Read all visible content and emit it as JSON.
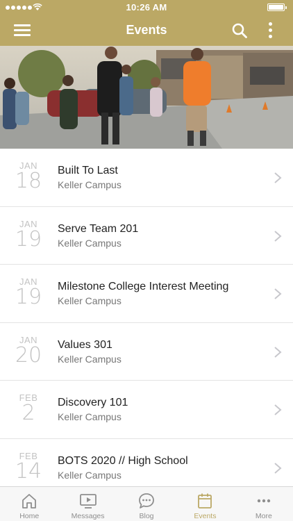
{
  "status_bar": {
    "time": "10:26 AM"
  },
  "nav": {
    "title": "Events"
  },
  "colors": {
    "accent": "#bba865",
    "inactive_tab": "#8e8e8e",
    "date_text": "#c3c3c3"
  },
  "events": [
    {
      "month": "JAN",
      "day": "18",
      "title": "Built To Last",
      "campus": "Keller Campus"
    },
    {
      "month": "JAN",
      "day": "19",
      "title": "Serve Team 201",
      "campus": "Keller Campus"
    },
    {
      "month": "JAN",
      "day": "19",
      "title": "Milestone College Interest Meeting",
      "campus": "Keller Campus"
    },
    {
      "month": "JAN",
      "day": "20",
      "title": "Values 301",
      "campus": "Keller Campus"
    },
    {
      "month": "FEB",
      "day": "2",
      "title": "Discovery 101",
      "campus": "Keller Campus"
    },
    {
      "month": "FEB",
      "day": "14",
      "title": "BOTS 2020 // High School",
      "campus": "Keller Campus"
    }
  ],
  "tabs": [
    {
      "label": "Home",
      "icon": "home-icon",
      "active": false
    },
    {
      "label": "Messages",
      "icon": "tv-icon",
      "active": false
    },
    {
      "label": "Blog",
      "icon": "chat-bubble-icon",
      "active": false
    },
    {
      "label": "Events",
      "icon": "calendar-icon",
      "active": true
    },
    {
      "label": "More",
      "icon": "ellipsis-icon",
      "active": false
    }
  ]
}
